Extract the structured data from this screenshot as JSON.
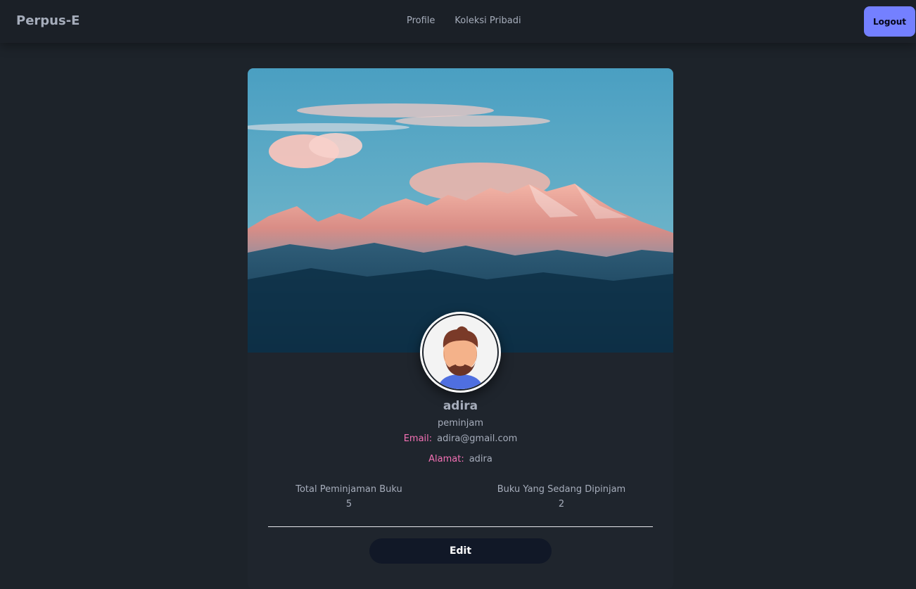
{
  "navbar": {
    "brand": "Perpus-E",
    "links": [
      "Profile",
      "Koleksi Pribadi"
    ],
    "logout_label": "Logout"
  },
  "profile": {
    "username": "adira",
    "role": "peminjam",
    "email_label": "Email:",
    "email": "adira@gmail.com",
    "address_label": "Alamat:",
    "address": "adira"
  },
  "stats": [
    {
      "label": "Total Peminjaman Buku",
      "value": "5"
    },
    {
      "label": "Buku Yang Sedang Dipinjam",
      "value": "2"
    }
  ],
  "actions": {
    "edit_label": "Edit"
  },
  "colors": {
    "background": "#1d232a",
    "accent": "#7480ff",
    "label_pink": "#f471b5",
    "button_dark": "#111827"
  },
  "images": {
    "cover": "mountain-landscape-photo",
    "avatar": "bearded-man-avatar"
  }
}
